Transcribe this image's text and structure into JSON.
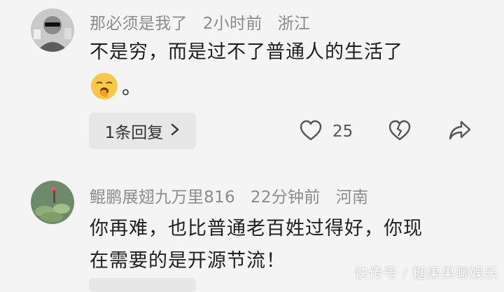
{
  "comments": [
    {
      "username": "那必须是我了",
      "time": "2小时前",
      "location": "浙江",
      "text_line1": "不是穷，而是过不了普通人的生活了",
      "text_after_emoji": "。",
      "emoji": "yawning-face-emoji",
      "reply_label": "1条回复",
      "likes": "25"
    },
    {
      "username": "鲲鹏展翅九万里816",
      "time": "22分钟前",
      "location": "河南",
      "text_line1": "你再难，也比普通老百姓过得好，你现",
      "text_line2": "在需要的是开源节流！"
    }
  ],
  "watermark": "快传号 / 糖果果聊娱乐",
  "icons": {
    "like": "heart-outline-icon",
    "dislike": "broken-heart-icon",
    "share": "share-arrow-icon",
    "reply_chevron": "chevron-right-icon"
  },
  "colors": {
    "background": "#f4f4f4",
    "meta_text": "#8b8b8b",
    "reply_button_bg": "#e7e7e7"
  }
}
